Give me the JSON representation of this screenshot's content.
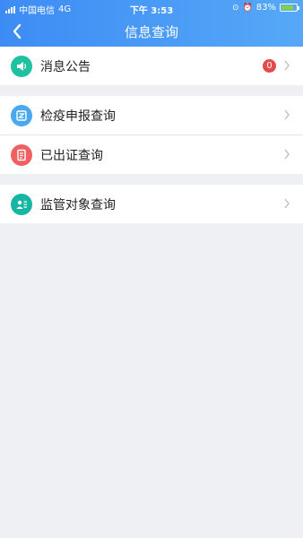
{
  "status_bar": {
    "carrier": "中国电信",
    "network": "4G",
    "time": "下午 3:53",
    "battery": "83%",
    "battery_level": 0.83
  },
  "nav": {
    "title": "信息查询",
    "back_icon": "chevron-left-icon"
  },
  "menu": {
    "notices": {
      "label": "消息公告",
      "badge": "0",
      "icon": "speaker-icon",
      "color": "#1ec2a0"
    },
    "quarantine": {
      "label": "检疫申报查询",
      "icon": "report-icon",
      "color": "#4aa8f0"
    },
    "certificates": {
      "label": "已出证查询",
      "icon": "certificate-icon",
      "color": "#ef6161"
    },
    "supervision": {
      "label": "监管对象查询",
      "icon": "person-card-icon",
      "color": "#17b6a4"
    }
  },
  "colors": {
    "header_start": "#3d8cf5",
    "header_end": "#56a8f7",
    "background": "#eff0f4",
    "badge": "#e34a4a"
  }
}
